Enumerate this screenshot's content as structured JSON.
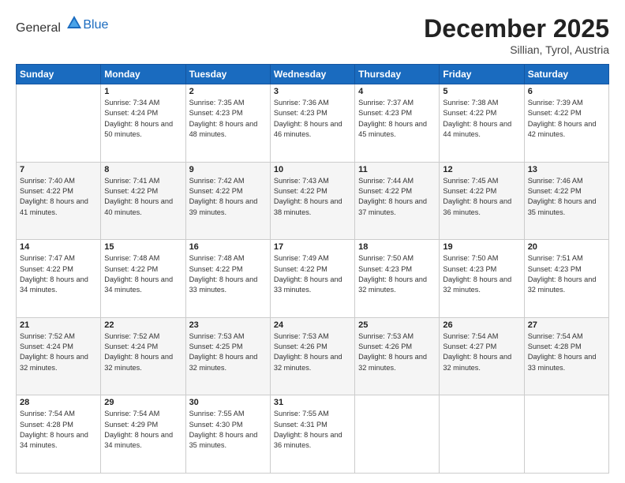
{
  "logo": {
    "general": "General",
    "blue": "Blue"
  },
  "header": {
    "month": "December 2025",
    "location": "Sillian, Tyrol, Austria"
  },
  "weekdays": [
    "Sunday",
    "Monday",
    "Tuesday",
    "Wednesday",
    "Thursday",
    "Friday",
    "Saturday"
  ],
  "weeks": [
    [
      {
        "day": "",
        "sunrise": "",
        "sunset": "",
        "daylight": ""
      },
      {
        "day": "1",
        "sunrise": "Sunrise: 7:34 AM",
        "sunset": "Sunset: 4:24 PM",
        "daylight": "Daylight: 8 hours and 50 minutes."
      },
      {
        "day": "2",
        "sunrise": "Sunrise: 7:35 AM",
        "sunset": "Sunset: 4:23 PM",
        "daylight": "Daylight: 8 hours and 48 minutes."
      },
      {
        "day": "3",
        "sunrise": "Sunrise: 7:36 AM",
        "sunset": "Sunset: 4:23 PM",
        "daylight": "Daylight: 8 hours and 46 minutes."
      },
      {
        "day": "4",
        "sunrise": "Sunrise: 7:37 AM",
        "sunset": "Sunset: 4:23 PM",
        "daylight": "Daylight: 8 hours and 45 minutes."
      },
      {
        "day": "5",
        "sunrise": "Sunrise: 7:38 AM",
        "sunset": "Sunset: 4:22 PM",
        "daylight": "Daylight: 8 hours and 44 minutes."
      },
      {
        "day": "6",
        "sunrise": "Sunrise: 7:39 AM",
        "sunset": "Sunset: 4:22 PM",
        "daylight": "Daylight: 8 hours and 42 minutes."
      }
    ],
    [
      {
        "day": "7",
        "sunrise": "Sunrise: 7:40 AM",
        "sunset": "Sunset: 4:22 PM",
        "daylight": "Daylight: 8 hours and 41 minutes."
      },
      {
        "day": "8",
        "sunrise": "Sunrise: 7:41 AM",
        "sunset": "Sunset: 4:22 PM",
        "daylight": "Daylight: 8 hours and 40 minutes."
      },
      {
        "day": "9",
        "sunrise": "Sunrise: 7:42 AM",
        "sunset": "Sunset: 4:22 PM",
        "daylight": "Daylight: 8 hours and 39 minutes."
      },
      {
        "day": "10",
        "sunrise": "Sunrise: 7:43 AM",
        "sunset": "Sunset: 4:22 PM",
        "daylight": "Daylight: 8 hours and 38 minutes."
      },
      {
        "day": "11",
        "sunrise": "Sunrise: 7:44 AM",
        "sunset": "Sunset: 4:22 PM",
        "daylight": "Daylight: 8 hours and 37 minutes."
      },
      {
        "day": "12",
        "sunrise": "Sunrise: 7:45 AM",
        "sunset": "Sunset: 4:22 PM",
        "daylight": "Daylight: 8 hours and 36 minutes."
      },
      {
        "day": "13",
        "sunrise": "Sunrise: 7:46 AM",
        "sunset": "Sunset: 4:22 PM",
        "daylight": "Daylight: 8 hours and 35 minutes."
      }
    ],
    [
      {
        "day": "14",
        "sunrise": "Sunrise: 7:47 AM",
        "sunset": "Sunset: 4:22 PM",
        "daylight": "Daylight: 8 hours and 34 minutes."
      },
      {
        "day": "15",
        "sunrise": "Sunrise: 7:48 AM",
        "sunset": "Sunset: 4:22 PM",
        "daylight": "Daylight: 8 hours and 34 minutes."
      },
      {
        "day": "16",
        "sunrise": "Sunrise: 7:48 AM",
        "sunset": "Sunset: 4:22 PM",
        "daylight": "Daylight: 8 hours and 33 minutes."
      },
      {
        "day": "17",
        "sunrise": "Sunrise: 7:49 AM",
        "sunset": "Sunset: 4:22 PM",
        "daylight": "Daylight: 8 hours and 33 minutes."
      },
      {
        "day": "18",
        "sunrise": "Sunrise: 7:50 AM",
        "sunset": "Sunset: 4:23 PM",
        "daylight": "Daylight: 8 hours and 32 minutes."
      },
      {
        "day": "19",
        "sunrise": "Sunrise: 7:50 AM",
        "sunset": "Sunset: 4:23 PM",
        "daylight": "Daylight: 8 hours and 32 minutes."
      },
      {
        "day": "20",
        "sunrise": "Sunrise: 7:51 AM",
        "sunset": "Sunset: 4:23 PM",
        "daylight": "Daylight: 8 hours and 32 minutes."
      }
    ],
    [
      {
        "day": "21",
        "sunrise": "Sunrise: 7:52 AM",
        "sunset": "Sunset: 4:24 PM",
        "daylight": "Daylight: 8 hours and 32 minutes."
      },
      {
        "day": "22",
        "sunrise": "Sunrise: 7:52 AM",
        "sunset": "Sunset: 4:24 PM",
        "daylight": "Daylight: 8 hours and 32 minutes."
      },
      {
        "day": "23",
        "sunrise": "Sunrise: 7:53 AM",
        "sunset": "Sunset: 4:25 PM",
        "daylight": "Daylight: 8 hours and 32 minutes."
      },
      {
        "day": "24",
        "sunrise": "Sunrise: 7:53 AM",
        "sunset": "Sunset: 4:26 PM",
        "daylight": "Daylight: 8 hours and 32 minutes."
      },
      {
        "day": "25",
        "sunrise": "Sunrise: 7:53 AM",
        "sunset": "Sunset: 4:26 PM",
        "daylight": "Daylight: 8 hours and 32 minutes."
      },
      {
        "day": "26",
        "sunrise": "Sunrise: 7:54 AM",
        "sunset": "Sunset: 4:27 PM",
        "daylight": "Daylight: 8 hours and 32 minutes."
      },
      {
        "day": "27",
        "sunrise": "Sunrise: 7:54 AM",
        "sunset": "Sunset: 4:28 PM",
        "daylight": "Daylight: 8 hours and 33 minutes."
      }
    ],
    [
      {
        "day": "28",
        "sunrise": "Sunrise: 7:54 AM",
        "sunset": "Sunset: 4:28 PM",
        "daylight": "Daylight: 8 hours and 34 minutes."
      },
      {
        "day": "29",
        "sunrise": "Sunrise: 7:54 AM",
        "sunset": "Sunset: 4:29 PM",
        "daylight": "Daylight: 8 hours and 34 minutes."
      },
      {
        "day": "30",
        "sunrise": "Sunrise: 7:55 AM",
        "sunset": "Sunset: 4:30 PM",
        "daylight": "Daylight: 8 hours and 35 minutes."
      },
      {
        "day": "31",
        "sunrise": "Sunrise: 7:55 AM",
        "sunset": "Sunset: 4:31 PM",
        "daylight": "Daylight: 8 hours and 36 minutes."
      },
      {
        "day": "",
        "sunrise": "",
        "sunset": "",
        "daylight": ""
      },
      {
        "day": "",
        "sunrise": "",
        "sunset": "",
        "daylight": ""
      },
      {
        "day": "",
        "sunrise": "",
        "sunset": "",
        "daylight": ""
      }
    ]
  ]
}
